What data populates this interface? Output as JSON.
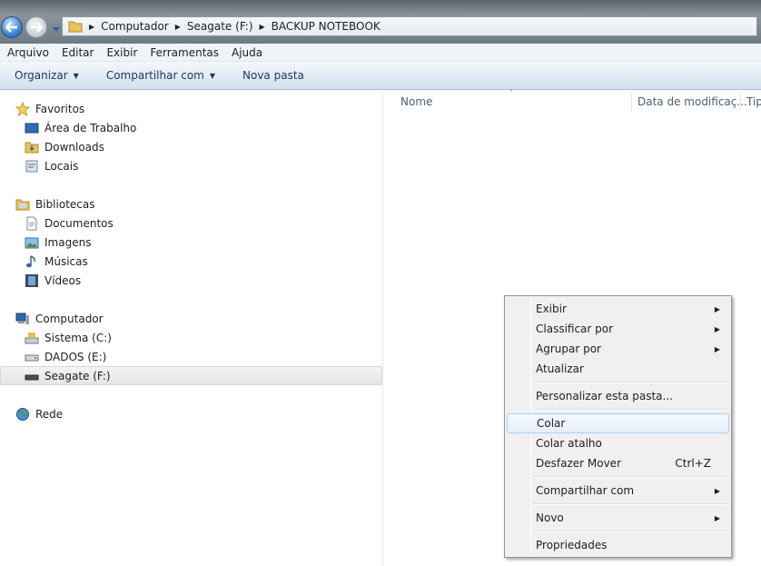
{
  "address": {
    "segments": [
      "Computador",
      "Seagate (F:)",
      "BACKUP NOTEBOOK"
    ]
  },
  "menu": [
    "Arquivo",
    "Editar",
    "Exibir",
    "Ferramentas",
    "Ajuda"
  ],
  "toolbar": {
    "organize": "Organizar",
    "share": "Compartilhar com",
    "new_folder": "Nova pasta"
  },
  "nav": {
    "favorites": "Favoritos",
    "desktop": "Área de Trabalho",
    "downloads": "Downloads",
    "recent": "Locais",
    "libraries": "Bibliotecas",
    "documents": "Documentos",
    "pictures": "Imagens",
    "music": "Músicas",
    "videos": "Vídeos",
    "computer": "Computador",
    "drive_c": "Sistema (C:)",
    "drive_e": "DADOS (E:)",
    "drive_f": "Seagate (F:)",
    "network": "Rede"
  },
  "columns": {
    "name": "Nome",
    "date": "Data de modificaç...",
    "type": "Tip"
  },
  "context_menu": {
    "view": "Exibir",
    "sort": "Classificar por",
    "group": "Agrupar por",
    "refresh": "Atualizar",
    "customize": "Personalizar esta pasta...",
    "paste": "Colar",
    "paste_shortcut": "Colar atalho",
    "undo": "Desfazer Mover",
    "undo_shortcut": "Ctrl+Z",
    "share": "Compartilhar com",
    "new": "Novo",
    "properties": "Propriedades"
  },
  "colors": {
    "accent": "#3a86d1",
    "hover_border": "#aecff7"
  }
}
